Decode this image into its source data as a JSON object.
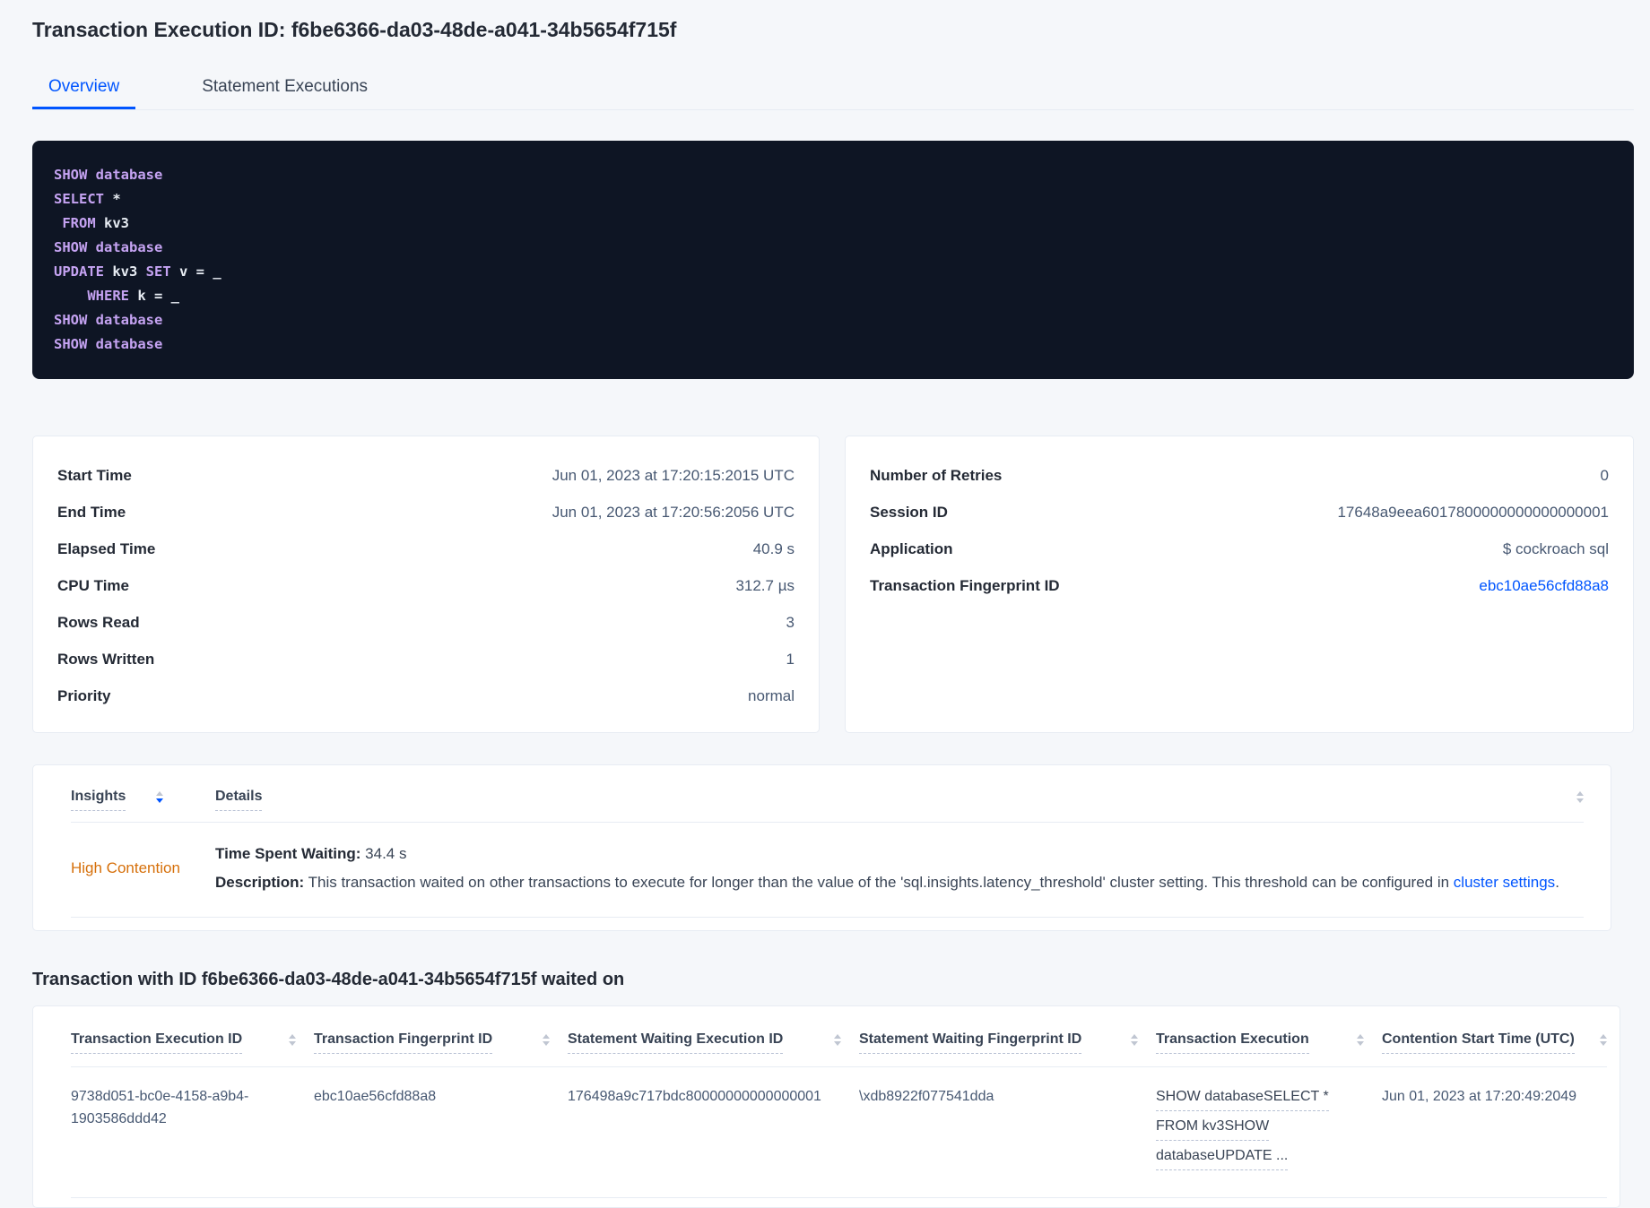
{
  "colors": {
    "accent": "#0055ff",
    "page-bg": "#f5f7fa",
    "card-border": "#e7ecf3",
    "heading-text": "#242a35",
    "body-text": "#394455",
    "value-text": "#475872",
    "link": "#0055ff",
    "warning-orange": "#d6700b",
    "code-bg": "#0e1524",
    "code-keyword": "#c5a3f2",
    "code-plain": "#e7ecf3",
    "dashed-underline": "#b8c1d4",
    "sort-arrow": "#c0c6d2"
  },
  "header": {
    "title": "Transaction Execution ID: f6be6366-da03-48de-a041-34b5654f715f"
  },
  "tabs": {
    "overview": "Overview",
    "statement_executions": "Statement Executions"
  },
  "sql": {
    "lines": [
      [
        {
          "t": "SHOW",
          "k": 1
        },
        {
          "t": " ",
          "k": 0
        },
        {
          "t": "database",
          "k": 1
        }
      ],
      [
        {
          "t": "SELECT",
          "k": 1
        },
        {
          "t": " *",
          "k": 0
        }
      ],
      [
        {
          "t": " ",
          "k": 0
        },
        {
          "t": "FROM",
          "k": 1
        },
        {
          "t": " kv3",
          "k": 0
        }
      ],
      [
        {
          "t": "SHOW",
          "k": 1
        },
        {
          "t": " ",
          "k": 0
        },
        {
          "t": "database",
          "k": 1
        }
      ],
      [
        {
          "t": "UPDATE",
          "k": 1
        },
        {
          "t": " kv3 ",
          "k": 0
        },
        {
          "t": "SET",
          "k": 1
        },
        {
          "t": " v = _",
          "k": 0
        }
      ],
      [
        {
          "t": "    ",
          "k": 0
        },
        {
          "t": "WHERE",
          "k": 1
        },
        {
          "t": " k = _",
          "k": 0
        }
      ],
      [
        {
          "t": "SHOW",
          "k": 1
        },
        {
          "t": " ",
          "k": 0
        },
        {
          "t": "database",
          "k": 1
        }
      ],
      [
        {
          "t": "SHOW",
          "k": 1
        },
        {
          "t": " ",
          "k": 0
        },
        {
          "t": "database",
          "k": 1
        }
      ]
    ]
  },
  "summary_left": {
    "rows": [
      {
        "label": "Start Time",
        "value": "Jun 01, 2023 at 17:20:15:2015 UTC"
      },
      {
        "label": "End Time",
        "value": "Jun 01, 2023 at 17:20:56:2056 UTC"
      },
      {
        "label": "Elapsed Time",
        "value": "40.9 s"
      },
      {
        "label": "CPU Time",
        "value": "312.7 µs"
      },
      {
        "label": "Rows Read",
        "value": "3"
      },
      {
        "label": "Rows Written",
        "value": "1"
      },
      {
        "label": "Priority",
        "value": "normal"
      }
    ]
  },
  "summary_right": {
    "rows": [
      {
        "label": "Number of Retries",
        "value": "0"
      },
      {
        "label": "Session ID",
        "value": "17648a9eea6017800000000000000001"
      },
      {
        "label": "Application",
        "value": "$ cockroach sql"
      }
    ],
    "fingerprint_label": "Transaction Fingerprint ID",
    "fingerprint_value": "ebc10ae56cfd88a8"
  },
  "insights_table": {
    "columns": {
      "insights": "Insights",
      "details": "Details"
    },
    "row": {
      "insight": "High Contention",
      "waiting_label": "Time Spent Waiting:",
      "waiting_value": " 34.4 s",
      "description_label": "Description:",
      "description_text": " This transaction waited on other transactions to execute for longer than the value of the 'sql.insights.latency_threshold' cluster setting. This threshold can be configured in ",
      "description_link": "cluster settings",
      "description_suffix": "."
    }
  },
  "waited_section": {
    "heading": "Transaction with ID f6be6366-da03-48de-a041-34b5654f715f waited on",
    "columns": [
      "Transaction Execution ID",
      "Transaction Fingerprint ID",
      "Statement Waiting Execution ID",
      "Statement Waiting Fingerprint ID",
      "Transaction Execution",
      "Contention Start Time (UTC)"
    ],
    "row": {
      "transaction_execution_id": "9738d051-bc0e-4158-a9b4-1903586ddd42",
      "transaction_fingerprint_id": "ebc10ae56cfd88a8",
      "statement_waiting_execution_id": "176498a9c717bdc80000000000000001",
      "statement_waiting_fingerprint_id": "\\xdb8922f077541dda",
      "transaction_execution_lines": [
        "SHOW databaseSELECT *",
        "FROM kv3SHOW",
        "databaseUPDATE ..."
      ],
      "contention_start_time": "Jun 01, 2023 at 17:20:49:2049"
    }
  }
}
